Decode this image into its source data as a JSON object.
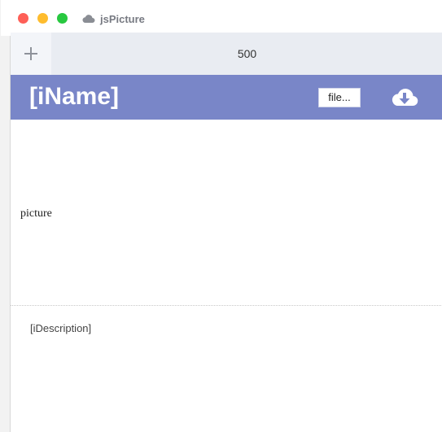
{
  "window": {
    "title": "jsPicture",
    "title_icon": "cloud-icon",
    "controls": {
      "close_color": "#fe5f57",
      "minimize_color": "#febc2e",
      "zoom_color": "#28c840"
    }
  },
  "tabs": {
    "add_icon": "plus-icon",
    "active_label": "500"
  },
  "header": {
    "app_name": "[iName]",
    "file_button_label": "file...",
    "download_icon": "cloud-download-icon",
    "accent_color": "#7986c8"
  },
  "content": {
    "picture_label": "picture",
    "description": "[iDescription]"
  }
}
